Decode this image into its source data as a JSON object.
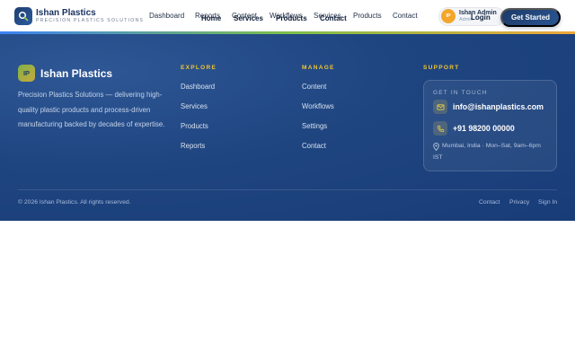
{
  "header": {
    "brand": {
      "name": "Ishan Plastics",
      "tagline": "PRECISION PLASTICS SOLUTIONS"
    },
    "nav_primary": [
      "Dashboard",
      "Reports",
      "Content",
      "Workflows",
      "Services",
      "Products",
      "Contact"
    ],
    "nav_secondary": [
      "Home",
      "Services",
      "Products",
      "Contact"
    ],
    "user": {
      "initials": "IP",
      "name": "Ishan Admin",
      "role": "Admin"
    },
    "login_label": "Login",
    "cta_label": "Get Started"
  },
  "footer": {
    "brand": {
      "initials": "IP",
      "name": "Ishan Plastics"
    },
    "description": "Precision Plastics Solutions — delivering high-quality plastic products and process-driven manufacturing backed by decades of expertise.",
    "columns": [
      {
        "title": "EXPLORE",
        "links": [
          "Dashboard",
          "Services",
          "Products",
          "Reports"
        ]
      },
      {
        "title": "MANAGE",
        "links": [
          "Content",
          "Workflows",
          "Settings",
          "Contact"
        ]
      }
    ],
    "support": {
      "title": "SUPPORT",
      "card_title": "GET IN TOUCH",
      "email": "info@ishanplastics.com",
      "phone": "+91 98200 00000",
      "address": "Mumbai, India · Mon–Sat, 9am–6pm IST"
    },
    "copyright": "© 2026 Ishan Plastics. All rights reserved.",
    "bottom_links": [
      "Contact",
      "Privacy",
      "Sign In"
    ]
  },
  "colors": {
    "primary_dark": "#183c78",
    "accent_yellow": "#f2c530",
    "avatar_orange": "#f4a62a",
    "cta_blue": "#1c3a68"
  },
  "icons": [
    "logo-search-icon",
    "mail-icon",
    "phone-icon",
    "map-pin-icon"
  ]
}
